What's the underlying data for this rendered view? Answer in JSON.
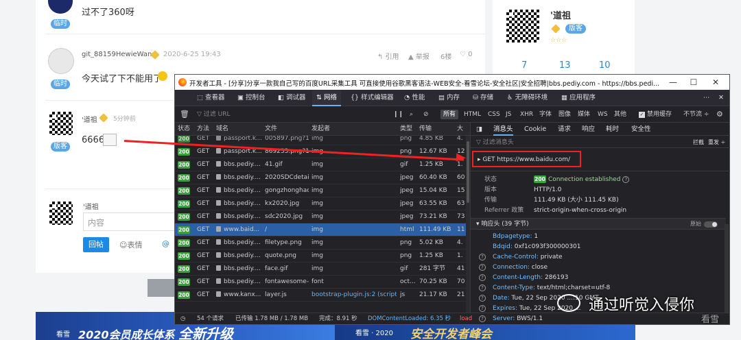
{
  "forum": {
    "post1": {
      "text": "过不了360呀",
      "tag": "临时"
    },
    "post2": {
      "user": "git_88159HewieWang",
      "time": "2020-6-25 19:43",
      "quote": "引用",
      "report": "举报",
      "floor": "6楼",
      "likes": "0",
      "text": "今天试了下不能用了",
      "tag": "临时"
    },
    "post3": {
      "user": "'道祖",
      "time": "5分钟前",
      "text": "6666",
      "tag": "版客"
    },
    "reply": {
      "user": "'道祖",
      "placeholder": "内容",
      "submit": "回帖",
      "emoji": "表情",
      "at": "@"
    },
    "sidebar": {
      "user": "'道祖",
      "tag": "版客",
      "stats": [
        "7",
        "13",
        "10"
      ]
    }
  },
  "banners": {
    "b1_prefix": "看雪",
    "b1_text": "2020会员成长体系",
    "b1_highlight": "全新升级",
    "b2_prefix": "看雪 · 2020",
    "b2_text": "安全开发者峰会"
  },
  "devtools": {
    "title": "开发者工具 - [分享]分享一款我自己写的百度URL采集工具 可直接使用谷歌黑客语法-WEB安全-看雪论坛-安全社区|安全招聘|bbs.pediy.com - https://bbs.pedi...",
    "tabs": [
      "查看器",
      "控制台",
      "调试器",
      "网络",
      "样式编辑器",
      "性能",
      "内存",
      "存储",
      "无障碍环境",
      "应用程序"
    ],
    "filter": {
      "placeholder": "过滤 URL",
      "types": [
        "所有",
        "HTML",
        "CSS",
        "JS",
        "XHR",
        "字体",
        "图像",
        "媒体",
        "WS",
        "其他"
      ],
      "disable_cache": "禁用缓存",
      "throttle": "不节流 ÷"
    },
    "columns": [
      "状态",
      "方法",
      "域名",
      "文件",
      "发起者",
      "类型",
      "传输",
      "大"
    ],
    "rows": [
      {
        "status": "200",
        "method": "GET",
        "domain": "passport.k...",
        "file": "869233.png?15",
        "initiator": "img",
        "type": "png",
        "size": "12.67 KB",
        "big": "12"
      },
      {
        "status": "200",
        "method": "GET",
        "domain": "bbs.pediy....",
        "file": "41.gif",
        "initiator": "img",
        "type": "gif",
        "size": "1.25 KB",
        "big": "1."
      },
      {
        "status": "200",
        "method": "GET",
        "domain": "bbs.pediy....",
        "file": "2020SDCdetail.",
        "initiator": "img",
        "type": "jpeg",
        "size": "60.40 KB",
        "big": "60"
      },
      {
        "status": "200",
        "method": "GET",
        "domain": "bbs.pediy....",
        "file": "gongzhonghao",
        "initiator": "img",
        "type": "jpeg",
        "size": "15.04 KB",
        "big": "15"
      },
      {
        "status": "200",
        "method": "GET",
        "domain": "bbs.pediy....",
        "file": "kx2020.jpg",
        "initiator": "img",
        "type": "jpeg",
        "size": "63.55 KB",
        "big": "63"
      },
      {
        "status": "200",
        "method": "GET",
        "domain": "bbs.pediy....",
        "file": "sdc2020.jpg",
        "initiator": "img",
        "type": "jpeg",
        "size": "73.21 KB",
        "big": "73"
      },
      {
        "status": "200",
        "method": "GET",
        "domain": "www.baid...",
        "file": "/",
        "initiator": "img",
        "type": "html",
        "size": "111.49 KB",
        "big": "11"
      },
      {
        "status": "200",
        "method": "GET",
        "domain": "bbs.pediy....",
        "file": "filetype.png",
        "initiator": "img",
        "type": "png",
        "size": "5.02 KB",
        "big": "4."
      },
      {
        "status": "200",
        "method": "GET",
        "domain": "bbs.pediy....",
        "file": "quote.png",
        "initiator": "img",
        "type": "png",
        "size": "1.25 KB",
        "big": "1."
      },
      {
        "status": "200",
        "method": "GET",
        "domain": "bbs.pediy....",
        "file": "face.gif",
        "initiator": "img",
        "type": "gif",
        "size": "281 字节",
        "big": "41"
      },
      {
        "status": "200",
        "method": "GET",
        "domain": "bbs.pediy....",
        "file": "fontawesome-v",
        "initiator": "font",
        "type": "oct...",
        "size": "70.25 KB",
        "big": "70"
      },
      {
        "status": "200",
        "method": "GET",
        "domain": "www.kanx...",
        "file": "layer.js",
        "initiator": "bootstrap-plugin.js:2 (script)",
        "type": "js",
        "size": "21.17 KB",
        "big": "21"
      }
    ],
    "partial_row": {
      "status": "200",
      "method": "GET",
      "domain": "passport.k...",
      "file": "005897.png?15",
      "initiator": "img",
      "type": "png",
      "size": "4.85 KB",
      "big": "4."
    },
    "status": {
      "count": "54 个请求",
      "transferred": "已传输 1.78 MB / 1.78 MB",
      "finish": "完成：8.91 秒",
      "dcl": "DOMContentLoaded: 6.35 秒",
      "load": "load"
    },
    "detail": {
      "tabs": [
        "消息头",
        "Cookie",
        "请求",
        "响应",
        "耗时",
        "安全性"
      ],
      "filter_placeholder": "过滤消息头",
      "block": "拦截",
      "resend": "重发 ÷",
      "request_line": "GET  https://www.baidu.com/",
      "summary": [
        {
          "k": "状态",
          "v": "Connection established"
        },
        {
          "k": "版本",
          "v": "HTTP/1.0"
        },
        {
          "k": "传输",
          "v": "111.49 KB (大小 111.45 KB)"
        },
        {
          "k": "Referrer 政策",
          "v": "strict-origin-when-cross-origin"
        }
      ],
      "status_code": "200",
      "section": "响应头 (39 字节)",
      "raw": "原始",
      "headers": [
        {
          "k": "Bdpagetype:",
          "v": "1"
        },
        {
          "k": "Bdqid:",
          "v": "0xf1c093f300000301"
        },
        {
          "k": "Cache-Control:",
          "v": "private"
        },
        {
          "k": "Connection:",
          "v": "close"
        },
        {
          "k": "Content-Length:",
          "v": "286193"
        },
        {
          "k": "Content-Type:",
          "v": "text/html;charset=utf-8"
        },
        {
          "k": "Date:",
          "v": "Tue, 22 Sep 2020 ...:10 GMT"
        },
        {
          "k": "Expires:",
          "v": "Tue, 22 Sep 2020 ..."
        },
        {
          "k": "Server:",
          "v": "BWS/1.1"
        }
      ]
    }
  },
  "watermark": {
    "text": "通过听觉入侵你",
    "sub": "看雪"
  }
}
